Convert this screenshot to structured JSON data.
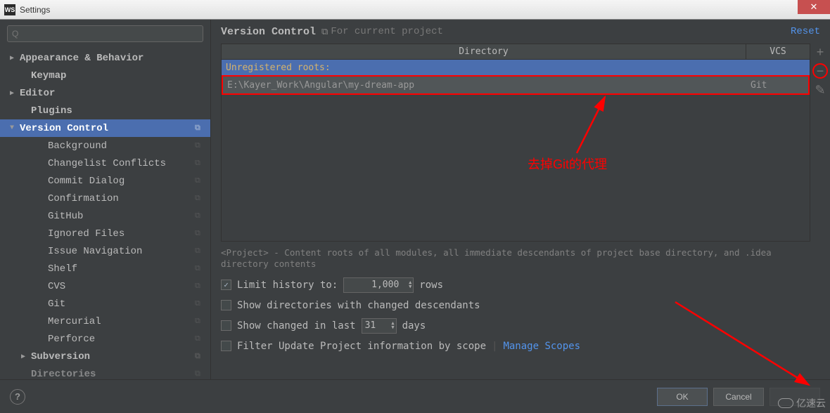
{
  "window": {
    "title": "Settings",
    "icon_text": "WS"
  },
  "search": {
    "placeholder": "Q"
  },
  "tree": {
    "items": [
      {
        "label": "Appearance & Behavior",
        "bold": true,
        "arrow": "▶",
        "lvl": 0
      },
      {
        "label": "Keymap",
        "bold": true,
        "lvl": 1
      },
      {
        "label": "Editor",
        "bold": true,
        "arrow": "▶",
        "lvl": 0
      },
      {
        "label": "Plugins",
        "bold": true,
        "lvl": 1
      },
      {
        "label": "Version Control",
        "bold": true,
        "arrow": "▼",
        "lvl": 0,
        "selected": true,
        "copy": true
      },
      {
        "label": "Background",
        "lvl": 2,
        "copy": true
      },
      {
        "label": "Changelist Conflicts",
        "lvl": 2,
        "copy": true
      },
      {
        "label": "Commit Dialog",
        "lvl": 2,
        "copy": true
      },
      {
        "label": "Confirmation",
        "lvl": 2,
        "copy": true
      },
      {
        "label": "GitHub",
        "lvl": 2,
        "copy": true
      },
      {
        "label": "Ignored Files",
        "lvl": 2,
        "copy": true
      },
      {
        "label": "Issue Navigation",
        "lvl": 2,
        "copy": true
      },
      {
        "label": "Shelf",
        "lvl": 2,
        "copy": true
      },
      {
        "label": "CVS",
        "lvl": 2,
        "copy": true
      },
      {
        "label": "Git",
        "lvl": 2,
        "copy": true
      },
      {
        "label": "Mercurial",
        "lvl": 2,
        "copy": true
      },
      {
        "label": "Perforce",
        "lvl": 2,
        "copy": true
      },
      {
        "label": "Subversion",
        "bold": true,
        "arrow": "▶",
        "lvl": 1,
        "copy": true
      },
      {
        "label": "Directories",
        "bold": true,
        "lvl": 1,
        "copy": true,
        "dim": true
      }
    ]
  },
  "header": {
    "breadcrumb": "Version Control",
    "subtitle": "For current project",
    "reset": "Reset"
  },
  "table": {
    "col_directory": "Directory",
    "col_vcs": "VCS",
    "unregistered_label": "Unregistered roots:",
    "row": {
      "directory": "E:\\Kayer_Work\\Angular\\my-dream-app",
      "vcs": "Git"
    }
  },
  "description": "<Project> - Content roots of all modules, all immediate descendants of project base directory, and .idea directory contents",
  "options": {
    "limit_history_label": "Limit history to:",
    "limit_history_value": "1,000",
    "limit_history_suffix": "rows",
    "limit_history_checked": true,
    "show_dirs_label": "Show directories with changed descendants",
    "show_changed_label_pre": "Show changed in last",
    "show_changed_value": "31",
    "show_changed_label_post": "days",
    "filter_label": "Filter Update Project information by scope",
    "manage_scopes": "Manage Scopes"
  },
  "buttons": {
    "ok": "OK",
    "cancel": "Cancel"
  },
  "annotation": {
    "text": "去掉Git的代理"
  },
  "watermark": "亿速云"
}
